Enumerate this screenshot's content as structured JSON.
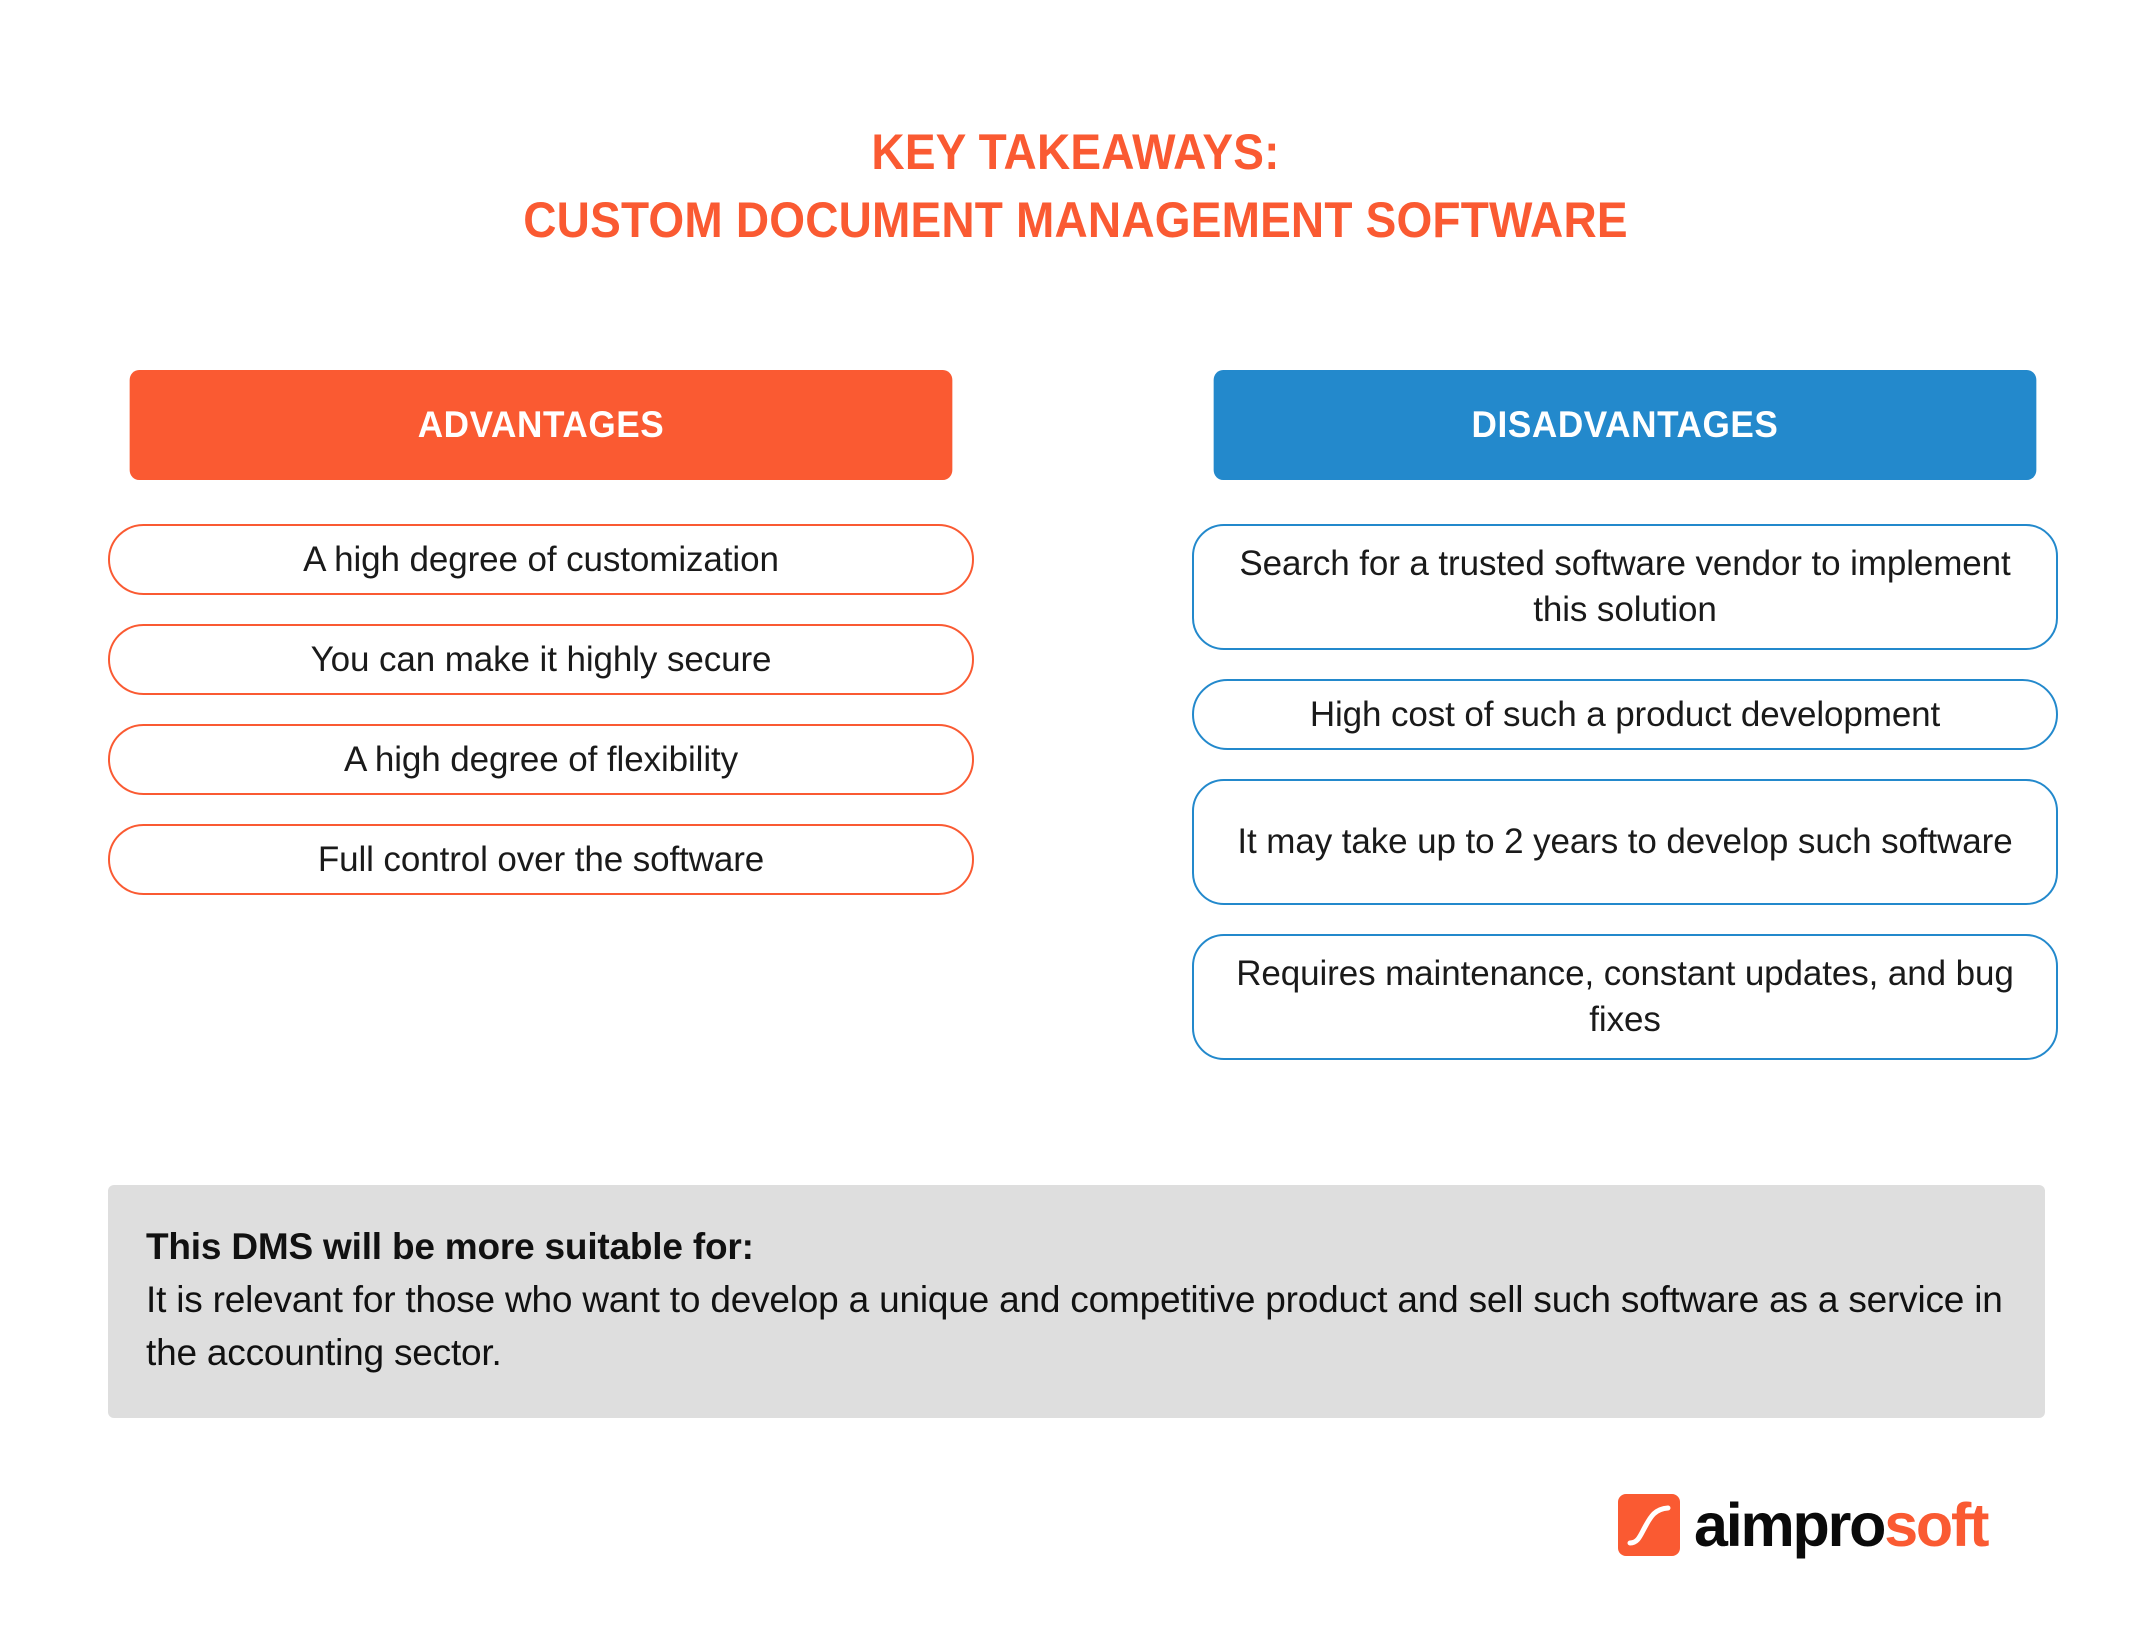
{
  "title": {
    "line1": "KEY TAKEAWAYS:",
    "line2": "CUSTOM DOCUMENT MANAGEMENT SOFTWARE",
    "color": "#FA5A32"
  },
  "columns": {
    "advantages": {
      "header": "ADVANTAGES",
      "header_bg": "#FA5A32",
      "border_color": "#FA5A32",
      "items": [
        "A high degree of customization",
        "You can make it highly secure",
        "A high degree of flexibility",
        "Full control over the software"
      ]
    },
    "disadvantages": {
      "header": "DISADVANTAGES",
      "header_bg": "#2389CC",
      "border_color": "#2389CC",
      "items": [
        "Search for a trusted software vendor to implement this solution",
        "High cost of such a product development",
        "It may take up to 2 years to develop such software",
        "Requires maintenance, constant updates, and bug fixes"
      ]
    }
  },
  "note": {
    "heading": "This DMS will be more suitable for:",
    "body": "It is relevant for those who want to develop a unique and competitive product and sell such software as a service in the accounting sector.",
    "background": "#DEDEDE"
  },
  "logo": {
    "mark": "s-curve-icon",
    "text_dark": "aimpro",
    "text_accent": "soft",
    "accent_color": "#FA5A32"
  }
}
